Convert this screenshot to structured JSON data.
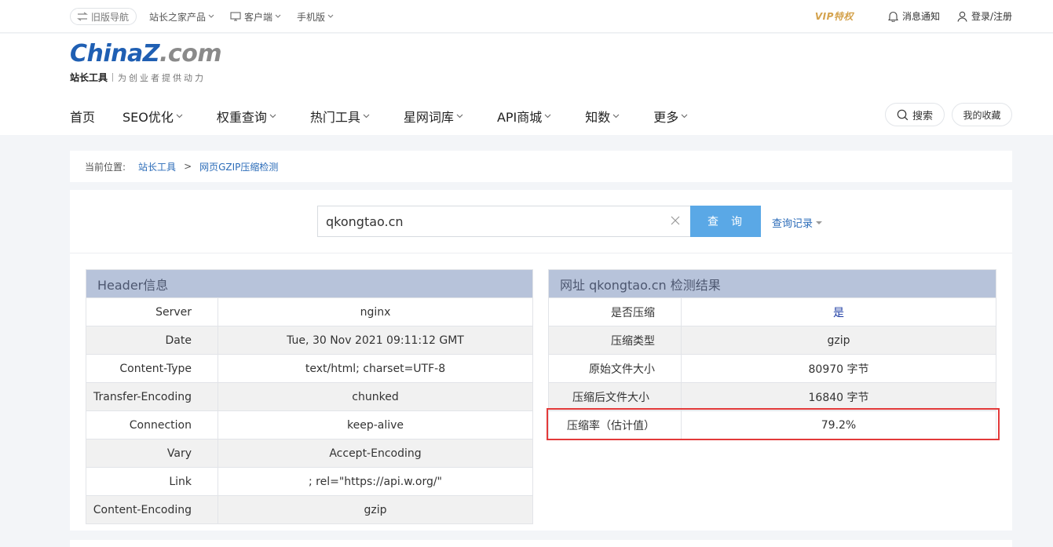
{
  "topbar": {
    "old_nav": "旧版导航",
    "items": [
      "站长之家产品",
      "客户端",
      "手机版"
    ],
    "vip": "VIP特权",
    "notify": "消息通知",
    "login": "登录/注册"
  },
  "logo": {
    "china": "China",
    "z": "Z",
    "com": ".com",
    "sub_title": "站长工具",
    "slogan": "为创业者提供动力"
  },
  "nav": {
    "items": [
      "首页",
      "SEO优化",
      "权重查询",
      "热门工具",
      "星网词库",
      "API商城",
      "知数",
      "更多"
    ],
    "search": "搜索",
    "favorites": "我的收藏"
  },
  "breadcrumb": {
    "label": "当前位置:",
    "crumb1": "站长工具",
    "sep": ">",
    "crumb2": "网页GZIP压缩检测"
  },
  "query": {
    "value": "qkongtao.cn",
    "button": "查询",
    "history": "查询记录"
  },
  "header_table": {
    "title": "Header信息",
    "rows": [
      {
        "k": "Server",
        "v": "nginx"
      },
      {
        "k": "Date",
        "v": "Tue, 30 Nov 2021 09:11:12 GMT"
      },
      {
        "k": "Content-Type",
        "v": "text/html; charset=UTF-8"
      },
      {
        "k": "Transfer-Encoding",
        "v": "chunked"
      },
      {
        "k": "Connection",
        "v": "keep-alive"
      },
      {
        "k": "Vary",
        "v": "Accept-Encoding"
      },
      {
        "k": "Link",
        "v": "; rel=\"https://api.w.org/\""
      },
      {
        "k": "Content-Encoding",
        "v": "gzip"
      }
    ]
  },
  "result_table": {
    "title": "网址 qkongtao.cn 检测结果",
    "rows": [
      {
        "k": "是否压缩",
        "v": "是"
      },
      {
        "k": "压缩类型",
        "v": "gzip"
      },
      {
        "k": "原始文件大小",
        "v": "80970 字节"
      },
      {
        "k": "压缩后文件大小",
        "v": "16840 字节"
      },
      {
        "k": "压缩率（估计值）",
        "v": "79.2%"
      }
    ]
  },
  "colors": {
    "accent_blue": "#5aa8e6",
    "link_blue": "#2a6bb8",
    "table_header": "#b7c3da",
    "highlight_red": "#e33a3a",
    "vip_gold": "#d4a24c"
  }
}
